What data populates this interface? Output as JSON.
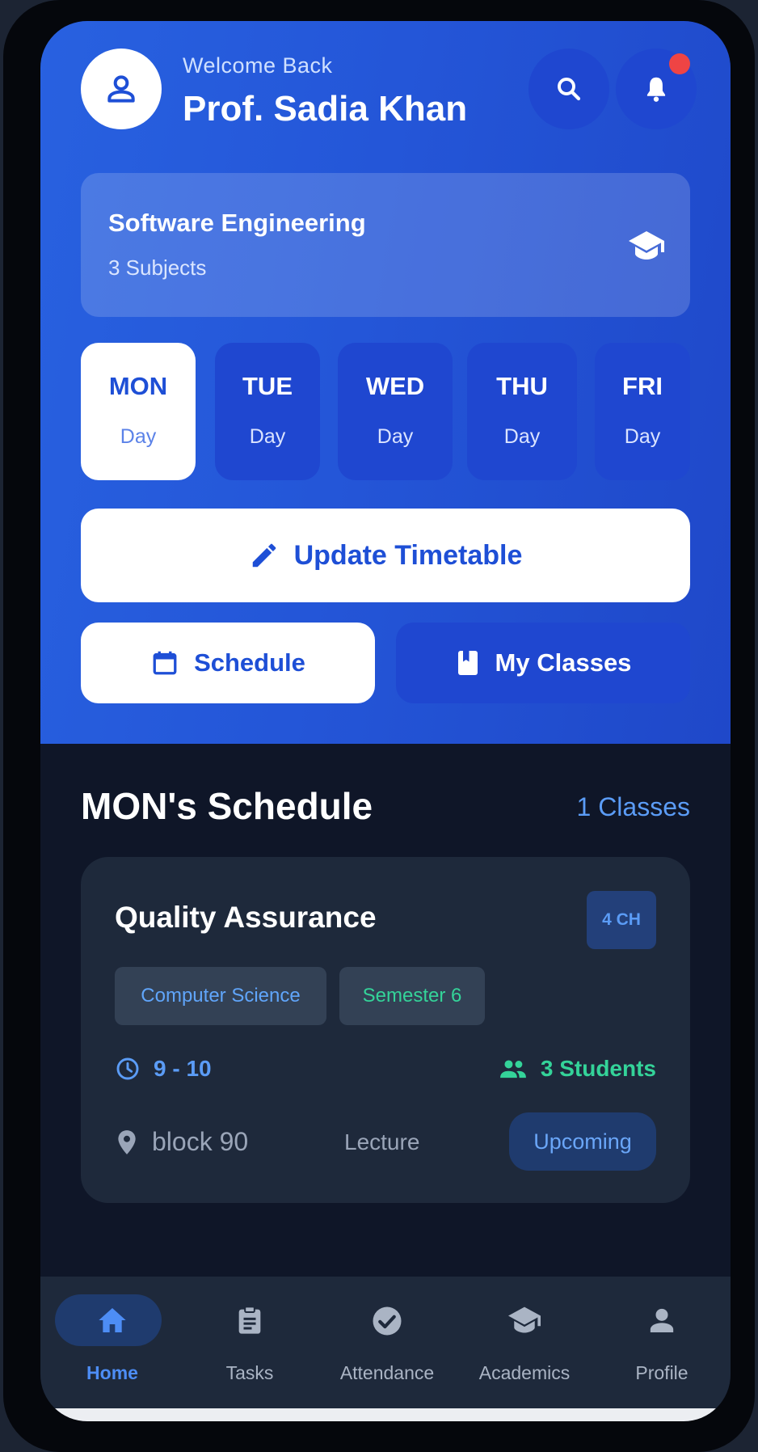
{
  "header": {
    "welcome": "Welcome Back",
    "name": "Prof. Sadia Khan",
    "avatar_icon": "person-icon",
    "search_icon": "search-icon",
    "bell_icon": "bell-icon"
  },
  "department": {
    "title": "Software Engineering",
    "subtitle": "3 Subjects",
    "icon": "graduation-cap-icon"
  },
  "days": [
    {
      "code": "MON",
      "label": "Day",
      "active": true
    },
    {
      "code": "TUE",
      "label": "Day",
      "active": false
    },
    {
      "code": "WED",
      "label": "Day",
      "active": false
    },
    {
      "code": "THU",
      "label": "Day",
      "active": false
    },
    {
      "code": "FRI",
      "label": "Day",
      "active": false
    }
  ],
  "actions": {
    "update_label": "Update Timetable",
    "schedule_label": "Schedule",
    "classes_label": "My Classes"
  },
  "schedule": {
    "title": "MON's Schedule",
    "count": "1 Classes",
    "classes": [
      {
        "name": "Quality Assurance",
        "credit": "4 CH",
        "department": "Computer Science",
        "semester": "Semester 6",
        "time": "9 - 10",
        "students": "3 Students",
        "location": "block 90",
        "type": "Lecture",
        "status": "Upcoming"
      }
    ]
  },
  "nav": {
    "items": [
      {
        "label": "Home",
        "icon": "home-icon",
        "active": true
      },
      {
        "label": "Tasks",
        "icon": "clipboard-icon",
        "active": false
      },
      {
        "label": "Attendance",
        "icon": "check-circle-icon",
        "active": false
      },
      {
        "label": "Academics",
        "icon": "graduation-cap-icon",
        "active": false
      },
      {
        "label": "Profile",
        "icon": "profile-icon",
        "active": false
      }
    ]
  },
  "colors": {
    "primary": "#2456d8",
    "accent_blue": "#5b9cf6",
    "accent_green": "#34d399",
    "card": "#1e293b",
    "background": "#0f1628",
    "notification": "#ef4444"
  }
}
